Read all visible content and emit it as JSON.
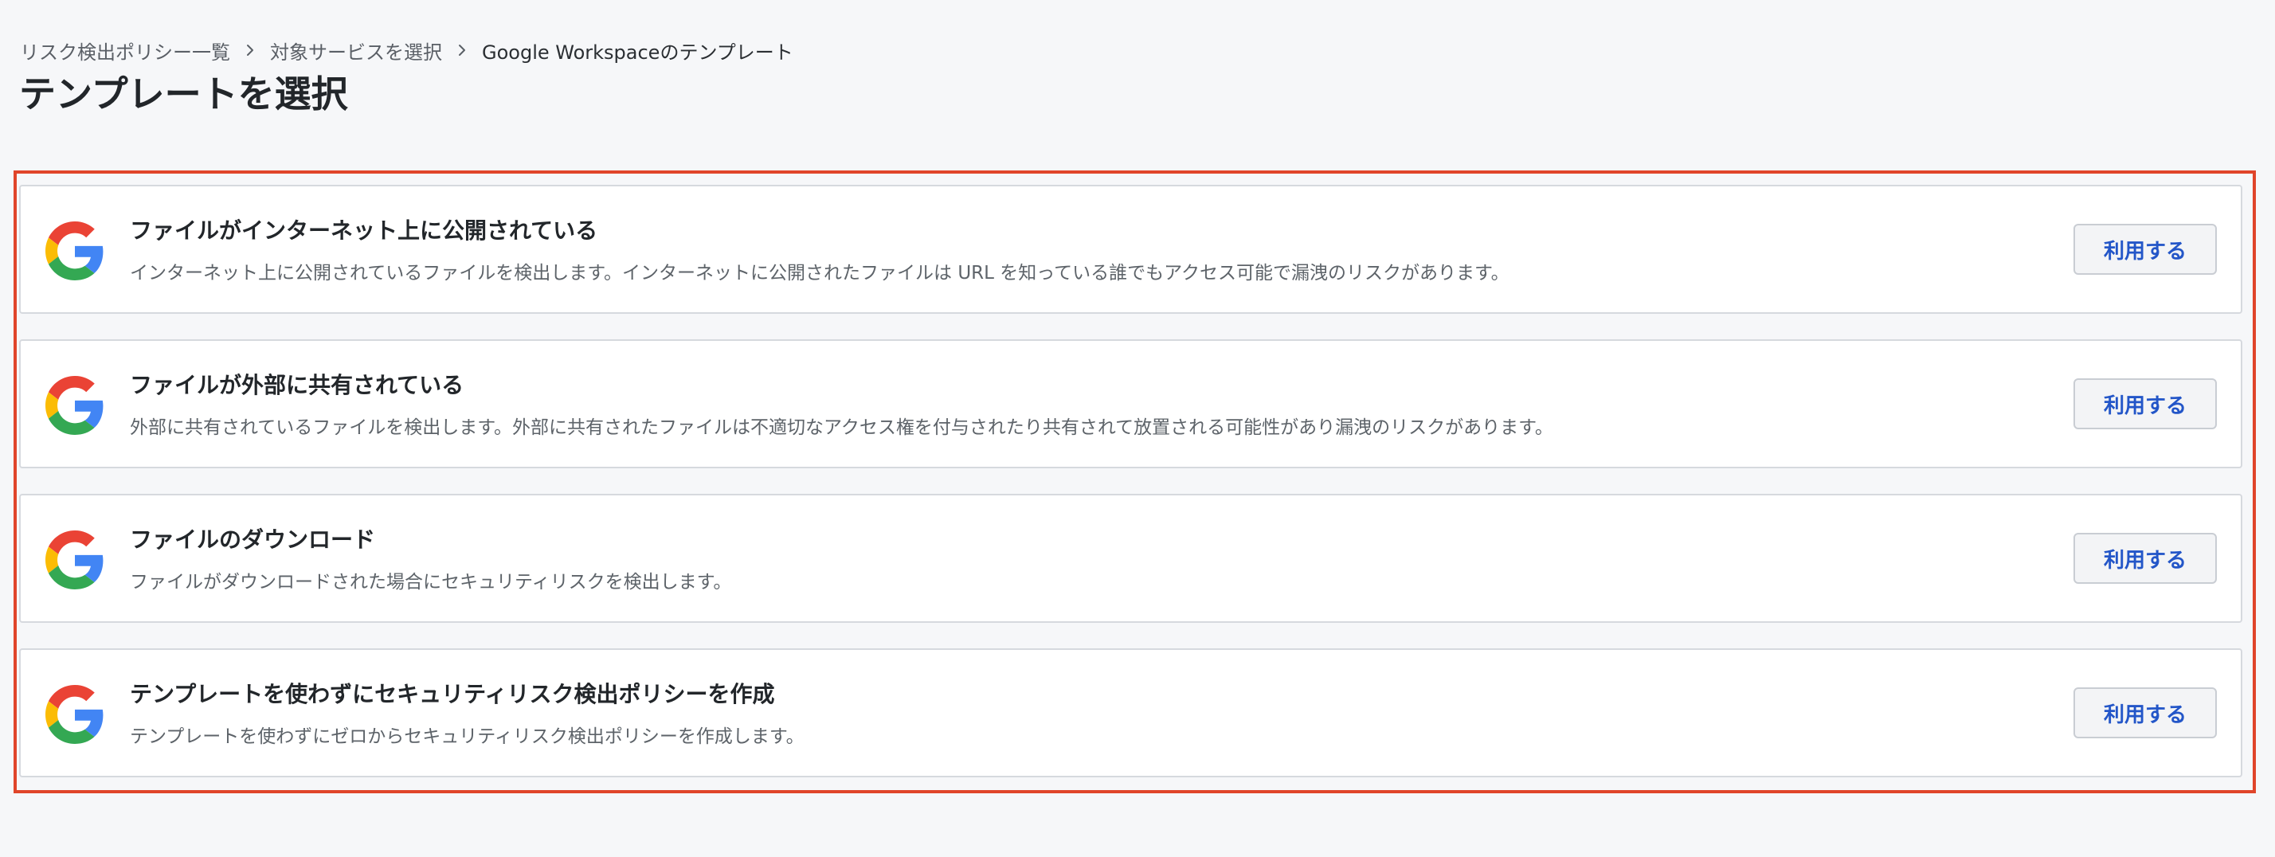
{
  "breadcrumb": {
    "items": [
      "リスク検出ポリシー一覧",
      "対象サービスを選択",
      "Google Workspaceのテンプレート"
    ]
  },
  "page": {
    "title": "テンプレートを選択"
  },
  "templates": [
    {
      "icon": "google-g-icon",
      "title": "ファイルがインターネット上に公開されている",
      "description": "インターネット上に公開されているファイルを検出します。インターネットに公開されたファイルは URL を知っている誰でもアクセス可能で漏洩のリスクがあります。",
      "button_label": "利用する"
    },
    {
      "icon": "google-g-icon",
      "title": "ファイルが外部に共有されている",
      "description": "外部に共有されているファイルを検出します。外部に共有されたファイルは不適切なアクセス権を付与されたり共有されて放置される可能性があり漏洩のリスクがあります。",
      "button_label": "利用する"
    },
    {
      "icon": "google-g-icon",
      "title": "ファイルのダウンロード",
      "description": "ファイルがダウンロードされた場合にセキュリティリスクを検出します。",
      "button_label": "利用する"
    },
    {
      "icon": "google-g-icon",
      "title": "テンプレートを使わずにセキュリティリスク検出ポリシーを作成",
      "description": "テンプレートを使わずにゼロからセキュリティリスク検出ポリシーを作成します。",
      "button_label": "利用する"
    }
  ],
  "colors": {
    "highlight": "#e0452a",
    "button_text": "#2356c8",
    "google_blue": "#4285F4",
    "google_red": "#EA4335",
    "google_yellow": "#FBBC05",
    "google_green": "#34A853"
  }
}
